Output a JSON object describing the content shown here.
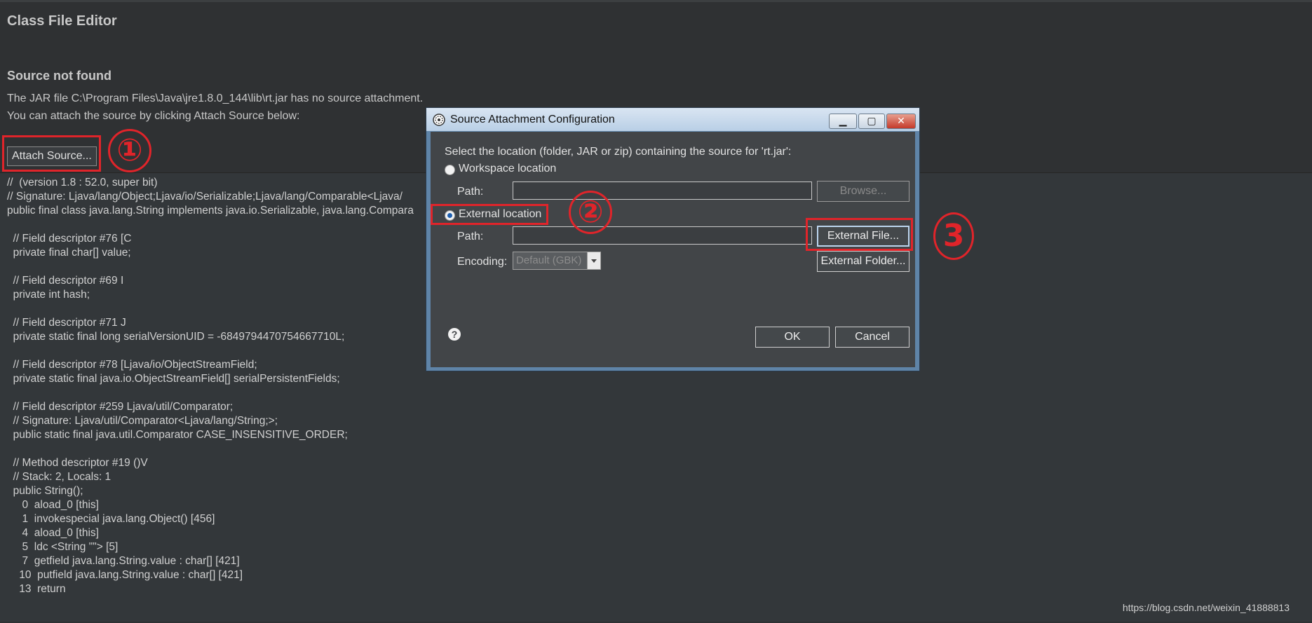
{
  "editor": {
    "title": "Class File Editor",
    "heading": "Source not found",
    "line1": "The JAR file C:\\Program Files\\Java\\jre1.8.0_144\\lib\\rt.jar has no source attachment.",
    "line2": "You can attach the source by clicking Attach Source below:",
    "attach_button": "Attach Source..."
  },
  "annotations": [
    "①",
    "②",
    "3"
  ],
  "code_lines": [
    "//  (version 1.8 : 52.0, super bit)",
    "// Signature: Ljava/lang/Object;Ljava/io/Serializable;Ljava/lang/Comparable<Ljava/",
    "public final class java.lang.String implements java.io.Serializable, java.lang.Compara",
    "",
    "  // Field descriptor #76 [C",
    "  private final char[] value;",
    "",
    "  // Field descriptor #69 I",
    "  private int hash;",
    "",
    "  // Field descriptor #71 J",
    "  private static final long serialVersionUID = -6849794470754667710L;",
    "",
    "  // Field descriptor #78 [Ljava/io/ObjectStreamField;",
    "  private static final java.io.ObjectStreamField[] serialPersistentFields;",
    "",
    "  // Field descriptor #259 Ljava/util/Comparator;",
    "  // Signature: Ljava/util/Comparator<Ljava/lang/String;>;",
    "  public static final java.util.Comparator CASE_INSENSITIVE_ORDER;",
    "",
    "  // Method descriptor #19 ()V",
    "  // Stack: 2, Locals: 1",
    "  public String();",
    "     0  aload_0 [this]",
    "     1  invokespecial java.lang.Object() [456]",
    "     4  aload_0 [this]",
    "     5  ldc <String \"\"> [5]",
    "     7  getfield java.lang.String.value : char[] [421]",
    "    10  putfield java.lang.String.value : char[] [421]",
    "    13  return"
  ],
  "watermark": "https://blog.csdn.net/weixin_41888813",
  "dialog": {
    "title": "Source Attachment Configuration",
    "window_buttons": {
      "minimize": "▁",
      "maximize": "▢",
      "close": "✕"
    },
    "prompt": "Select the location (folder, JAR or zip) containing the source for 'rt.jar':",
    "workspace_label": "Workspace location",
    "path_label": "Path:",
    "browse_button": "Browse...",
    "external_label": "External location",
    "path_label2": "Path:",
    "external_file_button": "External File...",
    "encoding_label": "Encoding:",
    "encoding_value": "Default (GBK)",
    "external_folder_button": "External Folder...",
    "help_glyph": "?",
    "ok_button": "OK",
    "cancel_button": "Cancel",
    "selected_option": "external"
  },
  "colors": {
    "annotation": "#e0242a",
    "dialog_body": "#424548",
    "editor_bg": "#2f3133"
  }
}
